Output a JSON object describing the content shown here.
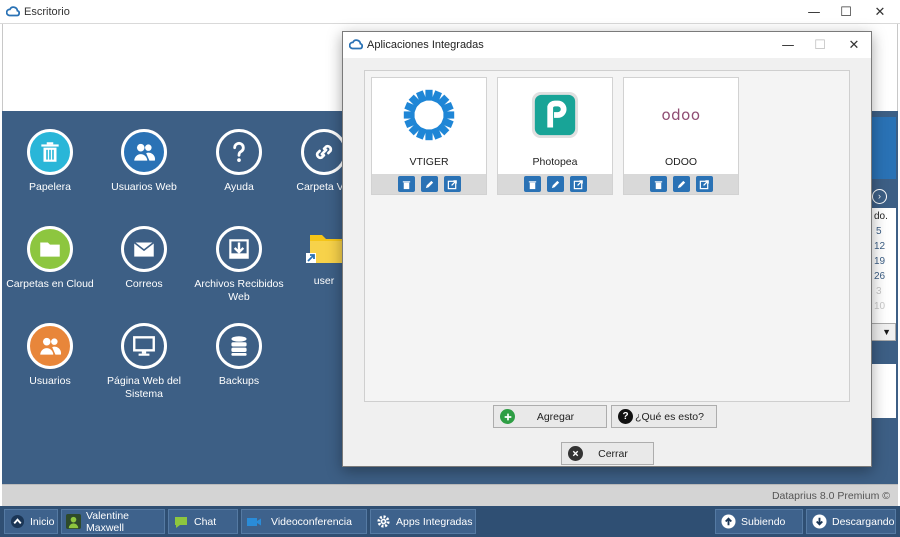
{
  "main_window": {
    "title": "Escritorio"
  },
  "desktop_icons": [
    {
      "label": "Papelera",
      "color": "#29b6d8",
      "icon": "trash-icon"
    },
    {
      "label": "Usuarios Web",
      "color": "#2a72b5",
      "icon": "web-users-icon"
    },
    {
      "label": "Ayuda",
      "color": "#3d5f85",
      "icon": "help-icon"
    },
    {
      "label": "Carpeta Vin",
      "color": "#3d5f85",
      "icon": "link-icon"
    },
    {
      "label": "Carpetas en Cloud",
      "color": "#8dc63f",
      "icon": "folder-icon"
    },
    {
      "label": "Correos",
      "color": "#3d5f85",
      "icon": "mail-icon"
    },
    {
      "label": "Archivos Recibidos Web",
      "color": "#3d5f85",
      "icon": "inbox-icon"
    },
    {
      "label": "user",
      "color": "#f5c518",
      "icon": "folder-shortcut-icon"
    },
    {
      "label": "Usuarios",
      "color": "#e8863a",
      "icon": "users-icon"
    },
    {
      "label": "Página Web del Sistema",
      "color": "#3d5f85",
      "icon": "monitor-icon"
    },
    {
      "label": "Backups",
      "color": "#3d5f85",
      "icon": "database-icon"
    }
  ],
  "side_calendar": {
    "header": "do.",
    "days": [
      "5",
      "12",
      "19",
      "26",
      "3",
      "10"
    ]
  },
  "dialog": {
    "title": "Aplicaciones Integradas",
    "apps": [
      {
        "name": "VTIGER",
        "icon": "vtiger-logo"
      },
      {
        "name": "Photopea",
        "icon": "photopea-logo"
      },
      {
        "name": "ODOO",
        "icon": "odoo-logo",
        "logo_text": "odoo"
      }
    ],
    "add_label": "Agregar",
    "help_label": "¿Qué es esto?",
    "close_label": "Cerrar"
  },
  "statusbar": {
    "version": "Dataprius 8.0 Premium ©"
  },
  "taskbar": {
    "items": [
      {
        "label": "Inicio",
        "icon": "home-icon"
      },
      {
        "label": "Valentine Maxwell",
        "icon": "user-icon"
      },
      {
        "label": "Chat",
        "icon": "chat-icon"
      },
      {
        "label": "Videoconferencia",
        "icon": "video-icon"
      },
      {
        "label": "Apps Integradas",
        "icon": "gear-icon"
      },
      {
        "label": "Subiendo",
        "icon": "upload-icon"
      },
      {
        "label": "Descargando",
        "icon": "download-icon"
      }
    ]
  },
  "colors": {
    "accent": "#2a72b5",
    "desktop": "#3d5f85",
    "taskbar": "#2f4f73"
  }
}
